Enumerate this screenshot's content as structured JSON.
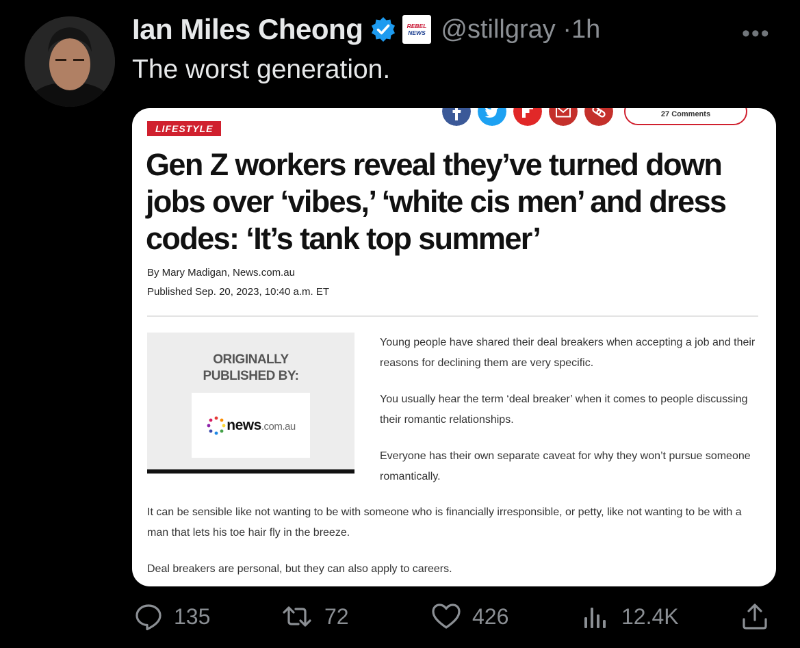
{
  "tweet": {
    "author_name": "Ian Miles Cheong",
    "handle": "@stillgray",
    "separator": "·",
    "time": "1h",
    "text": "The worst generation.",
    "icons": [
      "verified-badge-icon",
      "rebel-news-affiliate-icon",
      "more-icon"
    ]
  },
  "affiliate_badge": {
    "line1": "REBEL",
    "line2": "NEWS"
  },
  "article": {
    "share_buttons": [
      "facebook",
      "twitter",
      "flipboard",
      "email",
      "copy-link",
      "comments"
    ],
    "comments_label": "27 Comments",
    "section": "LIFESTYLE",
    "headline": "Gen Z workers reveal they’ve turned down jobs over ‘vibes,’ ‘white cis men’ and dress codes: ‘It’s tank top summer’",
    "byline": "By Mary Madigan, News.com.au",
    "published": "Published Sep. 20, 2023, 10:40 a.m. ET",
    "originally_published_label_1": "ORIGINALLY",
    "originally_published_label_2": "PUBLISHED BY:",
    "source_logo_main": "news",
    "source_logo_suffix": ".com.au",
    "paragraphs": [
      "Young people have shared their deal breakers when accepting a job and their reasons for declining them are very specific.",
      "You usually hear the term ‘deal breaker’ when it comes to people discussing their romantic relationships.",
      "Everyone has their own separate caveat for why they won’t pursue someone romantically.",
      "It can be sensible like not wanting to be with someone who is financially irresponsible, or petty, like not wanting to be with a man that lets his toe hair fly in the breeze.",
      "Deal breakers are personal, but they can also apply to careers."
    ]
  },
  "actions": {
    "replies": "135",
    "reposts": "72",
    "likes": "426",
    "views": "12.4K"
  },
  "colors": {
    "background": "#000000",
    "muted": "#8b8f94",
    "verified": "#1d9bf0",
    "article_red": "#d0202e"
  }
}
